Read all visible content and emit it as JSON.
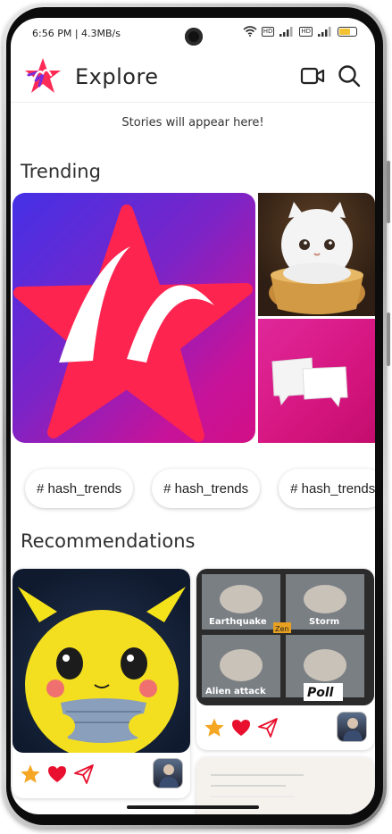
{
  "status_bar": {
    "time_speed": "6:56 PM | 4.3MB/s",
    "battery_color": "#f2c232",
    "icons": [
      "wifi-icon",
      "volte-icon",
      "signal-icon",
      "volte-icon",
      "signal-icon",
      "battery-icon"
    ],
    "sim_badge": "HD"
  },
  "app_bar": {
    "title": "Explore",
    "logo_colors": [
      "#ff2b56",
      "#7b2bd8"
    ],
    "actions": [
      "video-camera-icon",
      "search-icon"
    ]
  },
  "stories": {
    "empty_text": "Stories will appear here!"
  },
  "trending": {
    "title": "Trending",
    "tiles": [
      "app-logo-image",
      "fluffy-cat-cup-image",
      "speech-bubbles-image"
    ]
  },
  "hashtags": [
    "# hash_trends",
    "# hash_trends",
    "# hash_trends"
  ],
  "recommendations": {
    "title": "Recommendations",
    "cards": [
      {
        "image": "pikachu-plush-image",
        "actions": [
          "star-icon",
          "heart-icon",
          "share-icon"
        ]
      },
      {
        "image": "cat-meme-grid-image",
        "meme_labels": [
          "Earthquake",
          "Storm",
          "Zen",
          "Alien attack",
          "Poll"
        ],
        "actions": [
          "star-icon",
          "heart-icon",
          "share-icon"
        ]
      }
    ]
  },
  "colors": {
    "star": "#f5a623",
    "heart": "#e8102e",
    "share": "#e8102e",
    "accent": "#ff2b56"
  }
}
